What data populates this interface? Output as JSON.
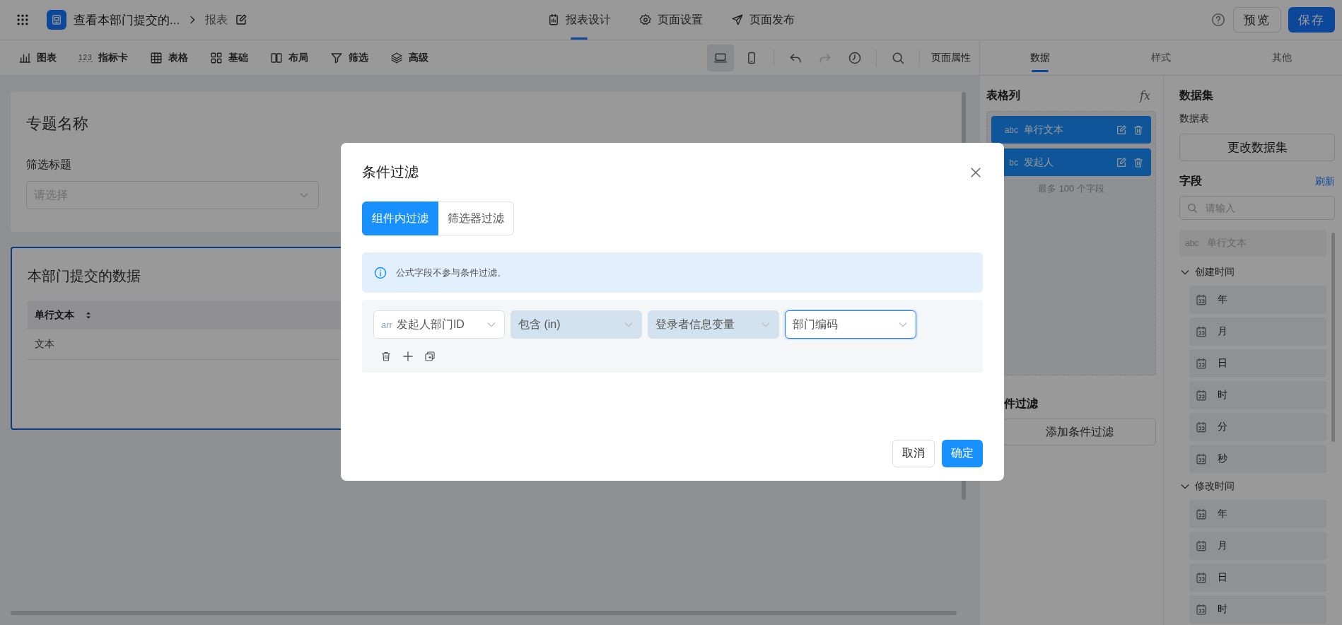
{
  "app_bar": {
    "title": "查看本部门提交的...",
    "breadcrumb": "报表",
    "tabs": [
      {
        "label": "报表设计",
        "selected": true
      },
      {
        "label": "页面设置",
        "selected": false
      },
      {
        "label": "页面发布",
        "selected": false
      }
    ],
    "buttons": [
      {
        "label": "预览",
        "kind": "default"
      },
      {
        "label": "保存",
        "kind": "primary"
      }
    ]
  },
  "toolbar": {
    "items": [
      {
        "label": "图表"
      },
      {
        "label": "指标卡",
        "glyph": "123"
      },
      {
        "label": "表格"
      },
      {
        "label": "基础"
      },
      {
        "label": "布局"
      },
      {
        "label": "筛选"
      },
      {
        "label": "高级"
      }
    ],
    "devices": [
      {
        "selected": true
      },
      {
        "selected": false
      }
    ],
    "history": [
      {
        "disabled": false
      },
      {
        "disabled": true
      },
      {
        "disabled": false
      }
    ],
    "page_properties": "页面属性"
  },
  "canvas": {
    "title_card": {
      "title": "专题名称",
      "filter_label": "筛选标题",
      "select_placeholder": "请选择"
    },
    "table_card": {
      "title": "本部门提交的数据",
      "selected": true,
      "columns": [
        "单行文本"
      ],
      "rows": [
        [
          "文本"
        ]
      ]
    }
  },
  "right_panel": {
    "tabs": [
      {
        "label": "数据",
        "selected": true
      },
      {
        "label": "样式",
        "selected": false
      },
      {
        "label": "其他",
        "selected": false
      }
    ],
    "columns_section": {
      "title": "表格列",
      "formula_glyph": "fx",
      "items": [
        {
          "tag": "abc",
          "label": "单行文本"
        },
        {
          "tag": "bc",
          "label": "发起人"
        }
      ],
      "limit_note": "最多 100 个字段"
    },
    "filter_section": {
      "title": "件过滤",
      "button": "添加条件过滤"
    },
    "dataset": {
      "title": "数据集",
      "subtitle": "数据表",
      "button": "更改数据集"
    },
    "fields": {
      "title": "字段",
      "refresh": "刷新",
      "search_placeholder": "请输入",
      "items": [
        {
          "kind": "field",
          "tag": "abc",
          "label": "单行文本",
          "disabled": true
        },
        {
          "kind": "group",
          "label": "创建时间",
          "expanded": true,
          "children": [
            {
              "label": "年"
            },
            {
              "label": "月"
            },
            {
              "label": "日"
            },
            {
              "label": "时"
            },
            {
              "label": "分"
            },
            {
              "label": "秒"
            }
          ]
        },
        {
          "kind": "group",
          "label": "修改时间",
          "expanded": true,
          "children": [
            {
              "label": "年"
            },
            {
              "label": "月"
            },
            {
              "label": "日"
            },
            {
              "label": "时"
            }
          ]
        }
      ]
    }
  },
  "dialog": {
    "title": "条件过滤",
    "tabs": [
      {
        "label": "组件内过滤",
        "selected": true
      },
      {
        "label": "筛选器过滤",
        "selected": false
      }
    ],
    "notice": "公式字段不参与条件过滤。",
    "conditions": [
      {
        "selects": [
          {
            "tag": "arr",
            "value": "发起人部门ID",
            "filled": false,
            "focused": false
          },
          {
            "value": "包含 (in)",
            "filled": true,
            "focused": false
          },
          {
            "value": "登录者信息变量",
            "filled": true,
            "focused": false
          },
          {
            "value": "部门编码",
            "filled": false,
            "focused": true
          }
        ]
      }
    ],
    "buttons": [
      {
        "label": "取消",
        "kind": "default"
      },
      {
        "label": "确定",
        "kind": "primary"
      }
    ]
  }
}
